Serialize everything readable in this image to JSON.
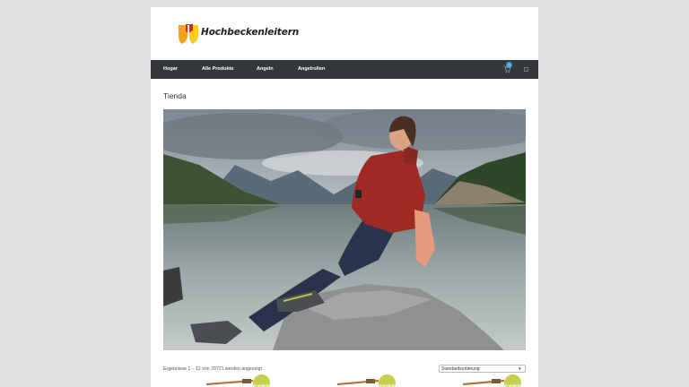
{
  "site": {
    "name": "Hochbeckenleitern",
    "colors": {
      "background": "#e2e2e2",
      "nav": "#33383b",
      "sale_badge": "#c5cf4a",
      "cart_badge": "#3aa0d8"
    }
  },
  "nav": {
    "items": [
      "Hogar",
      "Alle Produkte",
      "Angeln",
      "Angelrollen"
    ],
    "cart_icon": "cart-icon",
    "cart_count": "0",
    "search_icon": "search-icon"
  },
  "page": {
    "title": "Tienda"
  },
  "shop": {
    "results_text": "Ergebnisse 1 – 12 von 29721 werden angezeigt",
    "sort_selected": "Standardsortierung",
    "sale_label": "Angebot!",
    "product_count_visible": 3
  }
}
